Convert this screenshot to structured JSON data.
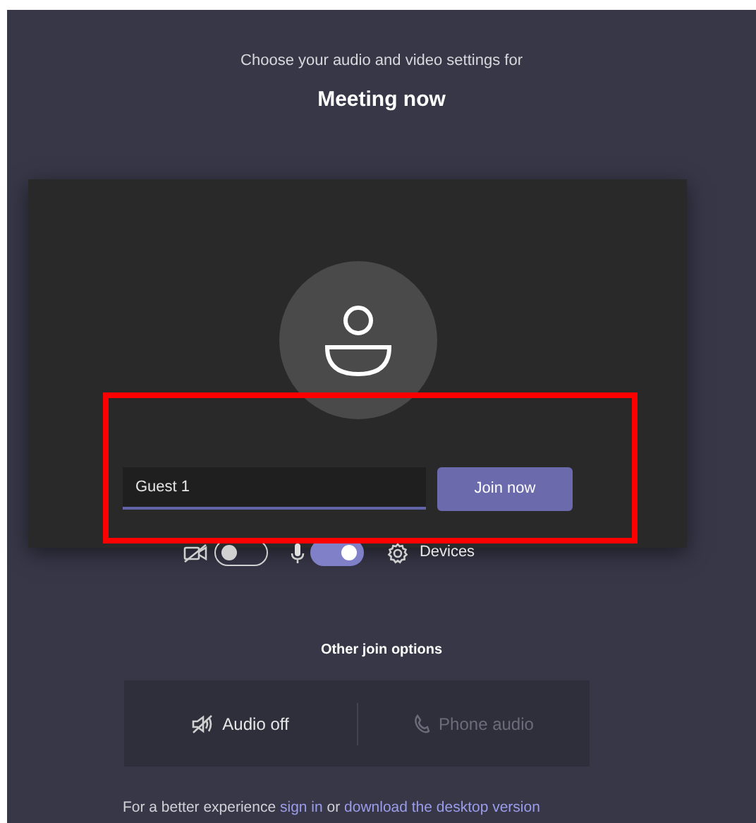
{
  "heading": "Choose your audio and video settings for",
  "meeting_title": "Meeting now",
  "name_field": {
    "value": "Guest 1"
  },
  "join_button": "Join now",
  "controls": [
    {
      "kind": "camera",
      "on": false
    },
    {
      "kind": "mic",
      "on": true
    },
    {
      "kind": "devices",
      "label": "Devices"
    }
  ],
  "other_options_title": "Other join options",
  "other_options": [
    {
      "kind": "audio-off",
      "label": "Audio off",
      "disabled": false
    },
    {
      "kind": "phone",
      "label": "Phone audio",
      "disabled": true
    }
  ],
  "footer": {
    "text": "For a better experience",
    "link1": "sign in",
    "middle": "or",
    "link2": "download the desktop version"
  }
}
